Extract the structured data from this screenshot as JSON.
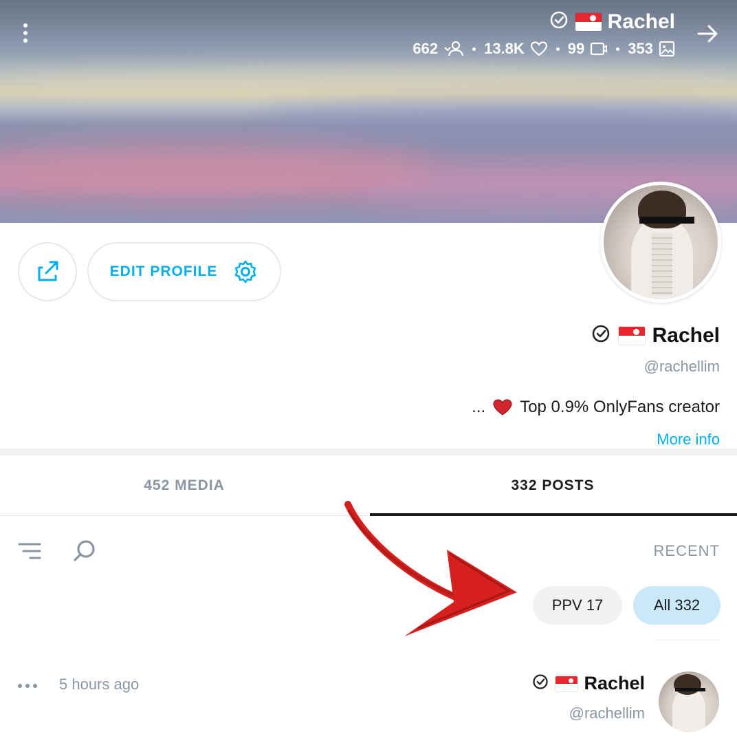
{
  "cover": {
    "name": "Rachel",
    "stats": {
      "photos": "353",
      "videos": "99",
      "likes": "13.8K",
      "fans": "662"
    }
  },
  "actions": {
    "edit_profile": "EDIT PROFILE"
  },
  "profile": {
    "name": "Rachel",
    "handle": "@rachellim",
    "bio": "Top 0.9% OnlyFans creator",
    "bio_ellipsis": "...",
    "more_info": "More info"
  },
  "tabs": {
    "posts": "332 POSTS",
    "media": "452 MEDIA"
  },
  "feed": {
    "section_label": "RECENT",
    "chips": {
      "all": "All 332",
      "ppv": "PPV 17"
    }
  },
  "post": {
    "author_name": "Rachel",
    "author_handle": "@rachellim",
    "time_ago": "5 hours ago"
  },
  "colors": {
    "accent": "#00aff0",
    "muted": "#8a96a3",
    "chip_active": "#c9e9fb",
    "annotation_arrow": "#d5201e"
  },
  "icons": [
    "more-vertical-icon",
    "verified-icon",
    "flag-icon",
    "image-icon",
    "video-icon",
    "heart-icon",
    "fans-icon",
    "arrow-right-icon",
    "gear-icon",
    "share-icon",
    "filter-icon",
    "search-icon",
    "ellipsis-icon"
  ]
}
